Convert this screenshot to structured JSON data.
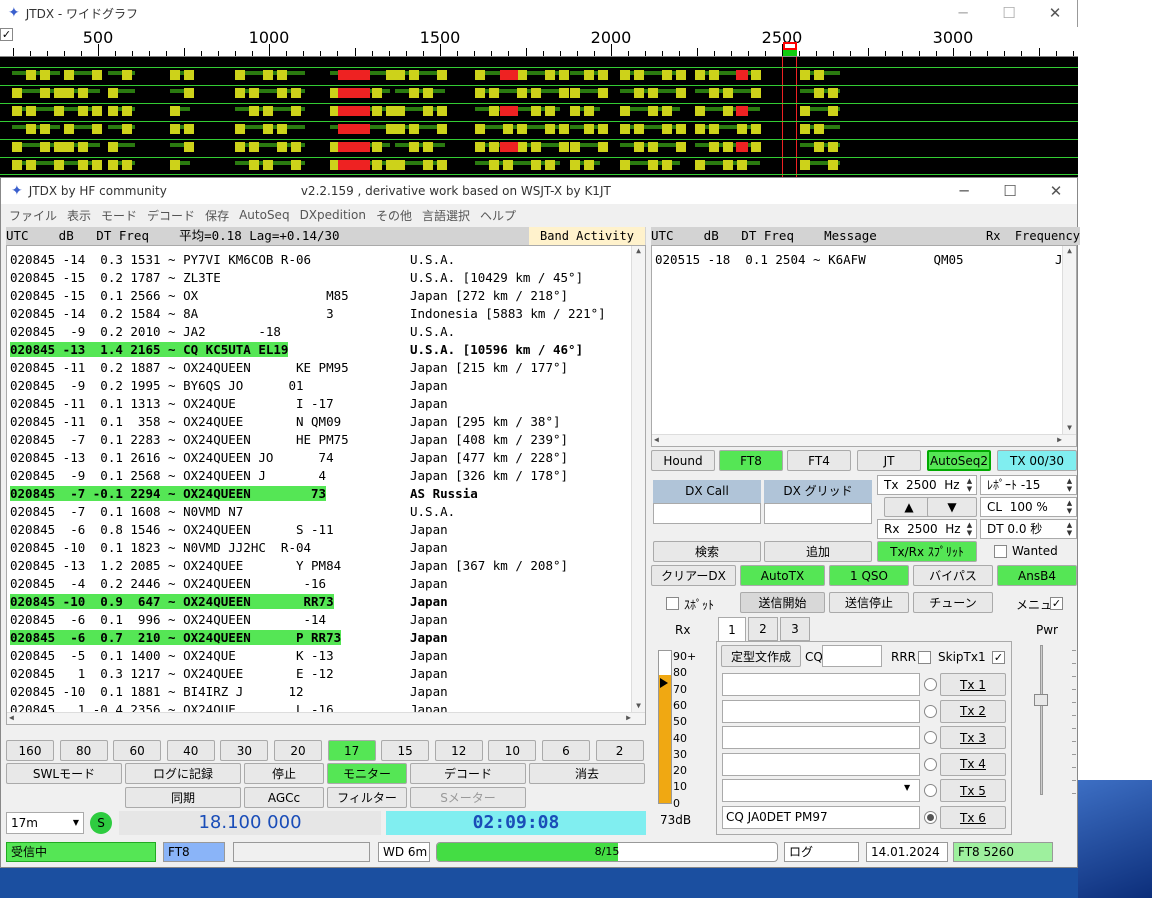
{
  "wf": {
    "title": "JTDX - ワイドグラフ",
    "check": "✓",
    "ticks": [
      "500",
      "1000",
      "1500",
      "2000",
      "2500",
      "3000"
    ]
  },
  "main": {
    "title": "JTDX  by HF community",
    "subtitle": "v2.2.159 , derivative work based on WSJT-X by K1JT",
    "menu": [
      "ファイル",
      "表示",
      "モード",
      "デコード",
      "保存",
      "AutoSeq",
      "DXpedition",
      "その他",
      "言語選択",
      "ヘルプ"
    ],
    "left_header": "UTC    dB   DT Freq    平均=0.18 Lag=+0.14/30",
    "band_activity": "Band Activity",
    "right_header": "UTC    dB   DT Freq    Message",
    "rx_freq": "Rx  Frequency"
  },
  "rows": [
    {
      "m": "020845 -14  0.3 1531 ~ PY7VI KM6COB R-06",
      "c": "U.S.A.",
      "hl": false
    },
    {
      "m": "020845 -15  0.2 1787 ~ ZL3TE",
      "c": "U.S.A. [10429 km / 45°]",
      "hl": false
    },
    {
      "m": "020845 -15  0.1 2566 ~ OX                 M85",
      "c": "Japan [272 km / 218°]",
      "hl": false
    },
    {
      "m": "020845 -14  0.2 1584 ~ 8A                 3",
      "c": "Indonesia [5883 km / 221°]",
      "hl": false
    },
    {
      "m": "020845  -9  0.2 2010 ~ JA2       -18",
      "c": "U.S.A.",
      "hl": false
    },
    {
      "m": "020845 -13  1.4 2165 ~ CQ KC5UTA EL19",
      "c": "U.S.A. [10596 km / 46°]",
      "hl": true
    },
    {
      "m": "020845 -11  0.2 1887 ~ OX24QUEEN      KE PM95",
      "c": "Japan [215 km / 177°]",
      "hl": false
    },
    {
      "m": "020845  -9  0.2 1995 ~ BY6QS JO      01",
      "c": "Japan",
      "hl": false
    },
    {
      "m": "020845 -11  0.1 1313 ~ OX24QUE        I -17",
      "c": "Japan",
      "hl": false
    },
    {
      "m": "020845 -11  0.1  358 ~ OX24QUEE       N QM09",
      "c": "Japan [295 km / 38°]",
      "hl": false
    },
    {
      "m": "020845  -7  0.1 2283 ~ OX24QUEEN      HE PM75",
      "c": "Japan [408 km / 239°]",
      "hl": false
    },
    {
      "m": "020845 -13  0.1 2616 ~ OX24QUEEN JO      74",
      "c": "Japan [477 km / 228°]",
      "hl": false
    },
    {
      "m": "020845  -9  0.1 2568 ~ OX24QUEEN J       4",
      "c": "Japan [326 km / 178°]",
      "hl": false
    },
    {
      "m": "020845  -7 -0.1 2294 ~ OX24QUEEN        73",
      "c": "AS Russia",
      "hl": true
    },
    {
      "m": "020845  -7  0.1 1608 ~ N0VMD N7",
      "c": "U.S.A.",
      "hl": false
    },
    {
      "m": "020845  -6  0.8 1546 ~ OX24QUEEN      S -11",
      "c": "Japan",
      "hl": false
    },
    {
      "m": "020845 -10  0.1 1823 ~ N0VMD JJ2HC  R-04",
      "c": "Japan",
      "hl": false
    },
    {
      "m": "020845 -13  1.2 2085 ~ OX24QUEE       Y PM84",
      "c": "Japan [367 km / 208°]",
      "hl": false
    },
    {
      "m": "020845  -4  0.2 2446 ~ OX24QUEEN       -16",
      "c": "Japan",
      "hl": false
    },
    {
      "m": "020845 -10  0.9  647 ~ OX24QUEEN       RR73",
      "c": "Japan",
      "hl": true
    },
    {
      "m": "020845  -6  0.1  996 ~ OX24QUEEN       -14",
      "c": "Japan",
      "hl": false
    },
    {
      "m": "020845  -6  0.7  210 ~ OX24QUEEN      P RR73",
      "c": "Japan",
      "hl": true
    },
    {
      "m": "020845  -5  0.1 1400 ~ OX24QUE        K -13",
      "c": "Japan",
      "hl": false
    },
    {
      "m": "020845   1  0.3 1217 ~ OX24QUEE       E -12",
      "c": "Japan",
      "hl": false
    },
    {
      "m": "020845 -10  0.1 1881 ~ BI4IRZ J      12",
      "c": "Japan",
      "hl": false
    },
    {
      "m": "020845   1 -0.4 2356 ~ OX24QUE        L -16",
      "c": "Japan",
      "hl": false
    }
  ],
  "right_rows": [
    {
      "m": "020515 -18  0.1 2504 ~ K6AFW         QM05",
      "e": "J"
    }
  ],
  "bands": [
    "160",
    "80",
    "60",
    "40",
    "30",
    "20",
    "17",
    "15",
    "12",
    "10",
    "6",
    "2"
  ],
  "row1": [
    "SWLモード",
    "ログに記録",
    "停止",
    "モニター",
    "デコード",
    "消去"
  ],
  "row2": [
    "同期",
    "AGCc",
    "フィルター",
    "Sメーター"
  ],
  "band_sel": "17m",
  "s_label": "S",
  "freq": "18.100 000",
  "time": "02:09:08",
  "modes": [
    "Hound",
    "FT8",
    "FT4",
    "JT",
    "AutoSeq2",
    "TX 00/30"
  ],
  "dxcall": "DX Call",
  "dxgrid": "DX グリッド",
  "tx": "Tx  2500  Hz",
  "rx": "Rx  2500  Hz",
  "report": "ﾚﾎﾟｰﾄ -15",
  "cl": "CL  100 %",
  "dt": "DT 0.0 秒",
  "up": "▲",
  "down": "▼",
  "search": "検索",
  "add": "追加",
  "txrx": "Tx/Rx ｽﾌﾟﾘｯﾄ",
  "wanted": "Wanted",
  "clear_dx": "クリアーDX",
  "autotx": "AutoTX",
  "oneqso": "1 QSO",
  "bypass": "バイパス",
  "ansb4": "AnsB4",
  "spot": "ｽﾎﾟｯﾄ",
  "tx_start": "送信開始",
  "tx_stop": "送信停止",
  "tune": "チューン",
  "menu_lbl": "メニュー",
  "check": "✓",
  "rx_lbl": "Rx",
  "pwr": "Pwr",
  "tabs": [
    "1",
    "2",
    "3"
  ],
  "template": "定型文作成",
  "cq": "CQ",
  "rrr": "RRR",
  "skiptx1": "SkipTx1",
  "tx_btns": [
    "Tx 1",
    "Tx 2",
    "Tx 3",
    "Tx 4",
    "Tx 5",
    "Tx 6"
  ],
  "tx6_msg": "CQ JA0DET PM97",
  "meter_labels": [
    "90+",
    "80",
    "70",
    "60",
    "50",
    "40",
    "30",
    "20",
    "10",
    "0"
  ],
  "meter_db": "73dB",
  "status": {
    "rx": "受信中",
    "mode": "FT8",
    "wd": "WD 6m",
    "progress": "8/15",
    "progress_value": 0.533,
    "log": "ログ",
    "date": "14.01.2024",
    "right": "FT8  5260"
  },
  "colors": {
    "green": "#55e655",
    "cyan": "#80eef0",
    "blue": "#1a4db8"
  }
}
